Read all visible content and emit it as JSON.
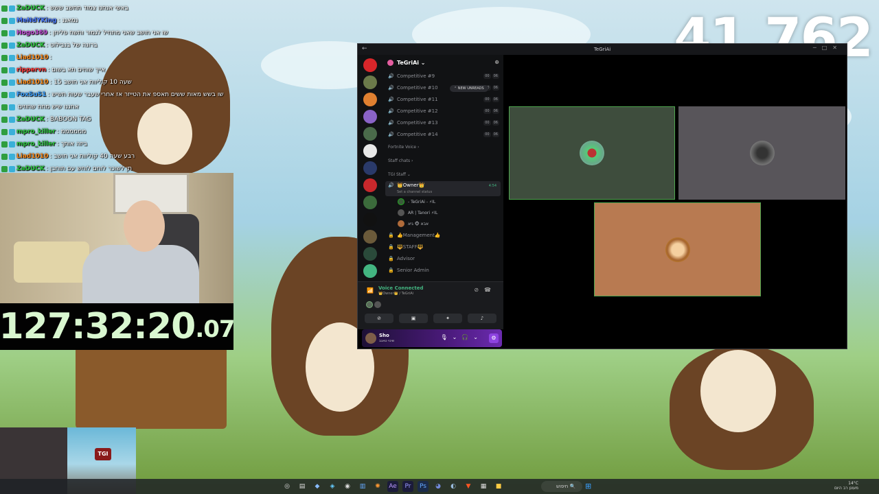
{
  "counter": "41,762",
  "timer": {
    "main": "127:32:20",
    "ms": ".07"
  },
  "chat": [
    {
      "name": "ZaDUCK",
      "color": "#2ecc40",
      "msg": ": באשי אנחנו צמוד תחשב ששש"
    },
    {
      "name": "MeNdYKing",
      "color": "#4e7dff",
      "msg": ": נמאגנ"
    },
    {
      "name": "Hogo369",
      "color": "#c44fd8",
      "msg": ": שו אני חושב שאני מתחיל לגמור ותשח פליחן"
    },
    {
      "name": "ZaDUCK",
      "color": "#2ecc40",
      "msg": ": ברונה של בנבילוט"
    },
    {
      "name": "Liad1010",
      "color": "#ff8c1a",
      "msg": ":"
    },
    {
      "name": "rippervn",
      "color": "#ff3b3b",
      "msg": ": אייך שוחים תא בשום"
    },
    {
      "name": "Liad1010",
      "color": "#ff8c1a",
      "msg": ": שעה 10 קוליוות אני חושב 15"
    },
    {
      "name": "FoxSuS1",
      "color": "#3aa0ff",
      "msg": ": שו בשש מאות ששים תאספ את הטייזר אז אחרי שעבר שעות תשיש"
    },
    {
      "name": "",
      "color": "#ffffff",
      "msg": "אחננו שיש מחח שחוזים"
    },
    {
      "name": "ZaDUCK",
      "color": "#2ecc40",
      "msg": ": BABOON TAG"
    },
    {
      "name": "mpro_killer",
      "color": "#2ecc40",
      "msg": ": ממממממ"
    },
    {
      "name": "mpro_killer",
      "color": "#2ecc40",
      "msg": ": ביזה אותך"
    },
    {
      "name": "Liad1010",
      "color": "#ff8c1a",
      "msg": ": רבע שעה 40 קוליוות אני חושב"
    },
    {
      "name": "ZaDUCK",
      "color": "#2ecc40",
      "msg": ": תן לשוכר לוחם לוחש עם תוחבן"
    }
  ],
  "discord": {
    "window_title": "TeGriAi",
    "server_name": "TeGriAi",
    "new_unreads": "NEW UNREADS",
    "channels": [
      {
        "name": "Competitive #9",
        "t1": "00",
        "t2": "06"
      },
      {
        "name": "Competitive #10",
        "t1": "00",
        "t2": "06"
      },
      {
        "name": "Competitive #11",
        "t1": "00",
        "t2": "06"
      },
      {
        "name": "Competitive #12",
        "t1": "00",
        "t2": "06"
      },
      {
        "name": "Competitive #13",
        "t1": "00",
        "t2": "06"
      },
      {
        "name": "Competitive #14",
        "t1": "00",
        "t2": "06"
      }
    ],
    "categories": [
      "Fortnite Voice",
      "Staff chats",
      "TGI Staff"
    ],
    "active_channel": {
      "name": "👑Owner👑",
      "status": "Set a channel status",
      "time": "4:54"
    },
    "members": [
      "- TeGriAi - ⚡IL",
      "AR | Tanori ⚡IL",
      "אבא 🐵 גיא"
    ],
    "locked": [
      "👍Management👍",
      "🔱STAFF🔱",
      "Advisor",
      "Senior Admin"
    ],
    "voice": {
      "status": "Voice Connected",
      "sub": "👑Owner👑 / TeGriAi"
    },
    "user": {
      "name": "Sho",
      "status": "שינוי טאגב"
    }
  },
  "taskbar": {
    "search": "חיפוש",
    "temp": "14°C",
    "weather": "מעונן רב היום"
  }
}
